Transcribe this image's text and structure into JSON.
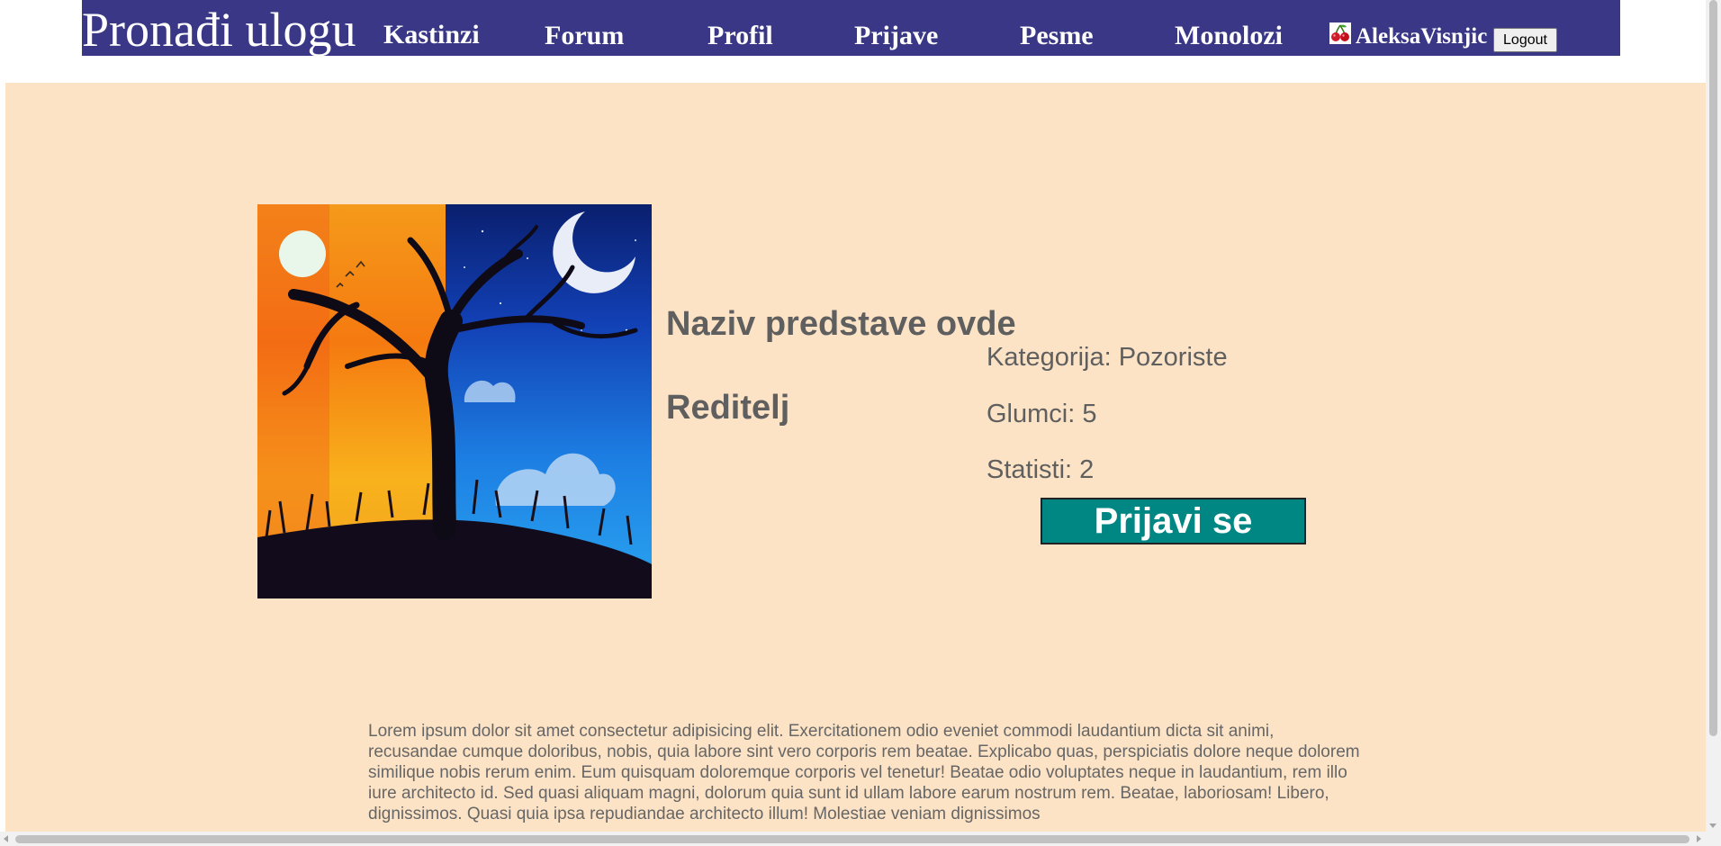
{
  "nav": {
    "brand": "Pronađi ulogu",
    "links": [
      "Kastinzi",
      "Forum",
      "Profil",
      "Prijave",
      "Pesme",
      "Monolozi"
    ],
    "username": "AleksaVisnjic",
    "user_icon": "cherry-icon",
    "logout_label": "Logout",
    "background_color": "#393786"
  },
  "show": {
    "title": "Naziv predstave ovde",
    "director": "Reditelj",
    "category": "Kategorija: Pozoriste",
    "actors": "Glumci: 5",
    "extras": "Statisti: 2",
    "apply_label": "Prijavi se",
    "apply_color": "#008784",
    "poster_image": "painting of a bare tree, half sunset (sun) half night sky (moon)",
    "description": "Lorem ipsum dolor sit amet consectetur adipisicing elit. Exercitationem odio eveniet commodi laudantium dicta sit animi, recusandae cumque doloribus, nobis, quia labore sint vero corporis rem beatae. Explicabo quas, perspiciatis dolore neque dolorem similique nobis rerum enim. Eum quisquam doloremque corporis vel tenetur! Beatae odio voluptates neque in laudantium, rem illo iure architecto id. Sed quasi aliquam magni, dolorum quia sunt id ullam labore earum nostrum rem. Beatae, laboriosam! Libero, dignissimos. Quasi quia ipsa repudiandae architecto illum! Molestiae veniam dignissimos"
  },
  "colors": {
    "page_background": "#fde3c5",
    "text": "#5f5f5f"
  }
}
